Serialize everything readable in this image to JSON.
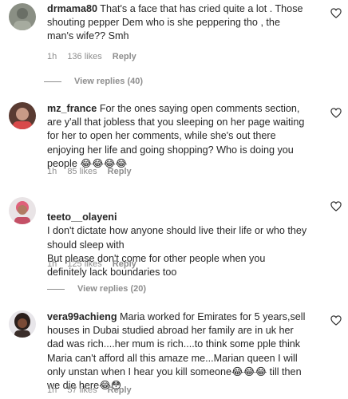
{
  "comments": [
    {
      "username": "drmama80",
      "text": "That's a face that has cried quite a lot . Those shouting pepper Dem who is she peppering tho , the man's wife?? Smh",
      "time": "1h",
      "likes": "136 likes",
      "reply": "Reply",
      "view_replies": "View replies (40)",
      "avatar_icon": "user-avatar-icon"
    },
    {
      "username": "mz_france",
      "text": "For the ones saying open comments section, are y'all that jobless that you sleeping on her page waiting for her to open her comments, while she's out there enjoying her life and going shopping? Who is doing you people 😂😂😂😂",
      "time": "1h",
      "likes": "85 likes",
      "reply": "Reply",
      "avatar_icon": "user-avatar-icon"
    },
    {
      "username": "teeto__olayeni",
      "text": "I don't dictate how anyone should live their life or who they should sleep with\nBut please don't come for other people when you definitely lack boundaries too",
      "time": "1h",
      "likes": "125 likes",
      "reply": "Reply",
      "view_replies": "View replies (20)",
      "avatar_icon": "user-avatar-icon"
    },
    {
      "username": "vera99achieng",
      "text": "Maria worked for Emirates for 5 years,sell houses in Dubai studied abroad her family are in uk her dad was rich....her mum is rich....to think some pple think Maria can't afford all this amaze me...Marian queen I will only unstan when I hear you kill someone😂😂😂 till then we die here😂😳",
      "time": "1h",
      "likes": "57 likes",
      "reply": "Reply",
      "avatar_icon": "user-avatar-icon"
    }
  ]
}
